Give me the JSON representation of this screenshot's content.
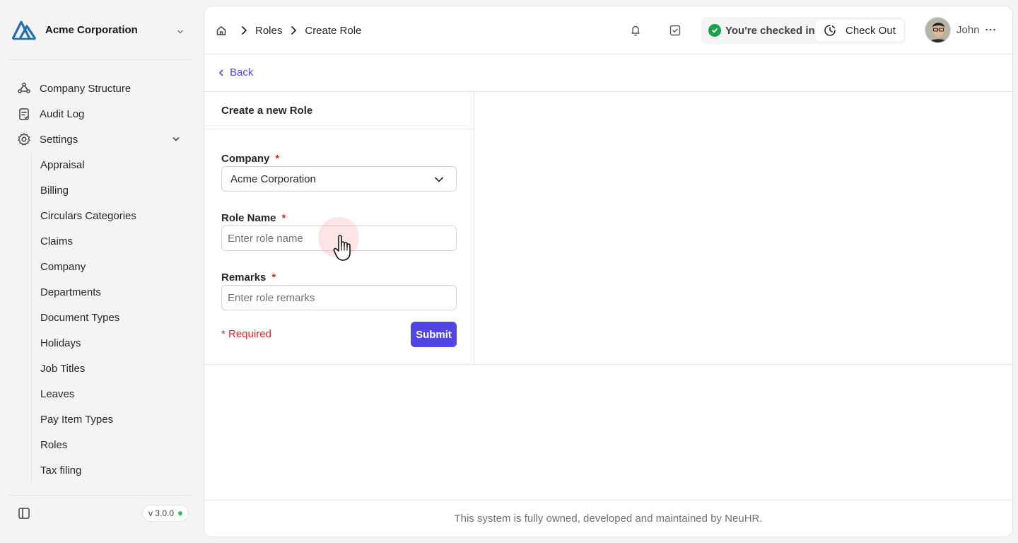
{
  "sidebar": {
    "org_name": "Acme Corporation",
    "logo_icon": "mountain-logo",
    "nav": [
      {
        "label": "Company Structure",
        "icon": "hierarchy-icon"
      },
      {
        "label": "Audit Log",
        "icon": "clipboard-icon"
      },
      {
        "label": "Settings",
        "icon": "gear-icon",
        "expanded": true
      }
    ],
    "settings_items": [
      "Appraisal",
      "Billing",
      "Circulars Categories",
      "Claims",
      "Company",
      "Departments",
      "Document Types",
      "Holidays",
      "Job Titles",
      "Leaves",
      "Pay Item Types",
      "Roles",
      "Tax filing"
    ],
    "version": "v 3.0.0",
    "version_status_color": "#22c55e"
  },
  "header": {
    "breadcrumbs": [
      "Roles",
      "Create Role"
    ],
    "checkin_status": "You're checked in",
    "checkout_label": "Check Out",
    "user_name": "John"
  },
  "main": {
    "back_label": "Back",
    "form_title": "Create a new Role",
    "fields": {
      "company": {
        "label": "Company",
        "required_mark": "*",
        "value": "Acme Corporation"
      },
      "role_name": {
        "label": "Role Name",
        "required_mark": "*",
        "value": "",
        "placeholder": "Enter role name"
      },
      "remarks": {
        "label": "Remarks",
        "required_mark": "*",
        "value": "",
        "placeholder": "Enter role remarks"
      }
    },
    "required_note": "* Required",
    "submit_label": "Submit"
  },
  "footer": {
    "text": "This system is fully owned, developed and maintained by NeuHR."
  },
  "colors": {
    "accent": "#4f46e5",
    "required": "#dc2626",
    "success": "#16a34a"
  }
}
